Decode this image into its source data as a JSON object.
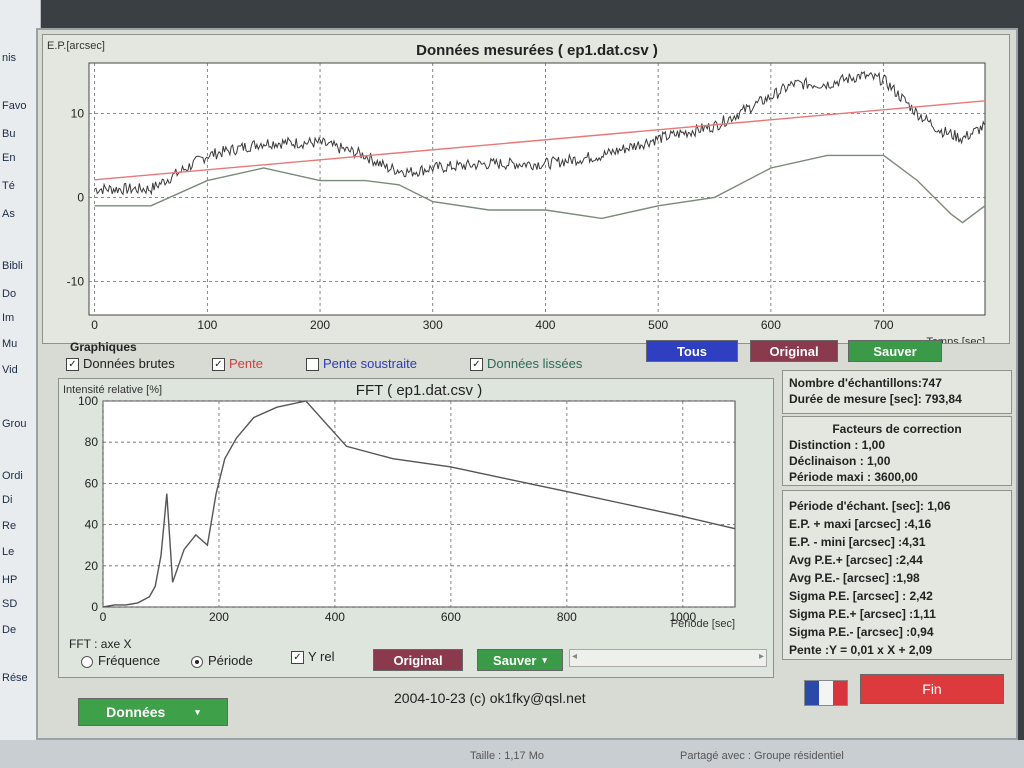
{
  "desktop": {
    "left_items": [
      "nis",
      "Favo",
      "Bu",
      "En",
      "Té",
      "As",
      "Bibli",
      "Do",
      "Im",
      "Mu",
      "Vid",
      "Grou",
      "Ordi",
      "Di",
      "Re",
      "Le",
      "HP",
      "SD",
      "De",
      "Rése"
    ]
  },
  "taskbar": {
    "size_text": "Taille : 1,17 Mo",
    "share_text": "Partagé avec : Groupe résidentiel"
  },
  "window": {
    "top_chart_title": "Données mesurées ( ep1.dat.csv )",
    "fft_chart_title": "FFT ( ep1.dat.csv )",
    "graphiques": {
      "label": "Graphiques",
      "donnees_brutes": "Données brutes",
      "pente": "Pente",
      "pente_soustraite": "Pente soustraite",
      "donnees_lissees": "Données lissées"
    },
    "buttons": {
      "tous": "Tous",
      "original_top": "Original",
      "sauver_top": "Sauver",
      "original_fft": "Original",
      "sauver_fft": "Sauver",
      "donnees": "Données",
      "fin": "Fin"
    },
    "fft_axe": {
      "label": "FFT : axe X",
      "frequence": "Fréquence",
      "periode": "Période",
      "y_rel": "Y rel"
    },
    "footer_text": "2004-10-23 (c) ok1fky@qsl.net",
    "colors": {
      "tous": "#2f3fc2",
      "original": "#8a3a4c",
      "sauver": "#3a9a48",
      "donnees": "#3fa04a",
      "fin": "#dd3a3e",
      "pente_line": "#e87878"
    }
  },
  "info": {
    "nombre": "Nombre d'échantillons:747",
    "duree": "Durée de mesure [sec]: 793,84",
    "facteurs_title": "Facteurs de correction",
    "distinction": "Distinction : 1,00",
    "declinaison": "Déclinaison : 1,00",
    "periode_maxi": "Période maxi : 3600,00",
    "stats": [
      "Période d'échant. [sec]: 1,06",
      "E.P. + maxi [arcsec] :4,16",
      "E.P. - mini [arcsec] :4,31",
      "Avg P.E.+ [arcsec] :2,44",
      "Avg P.E.- [arcsec] :1,98",
      "Sigma P.E. [arcsec] : 2,42",
      "Sigma P.E.+ [arcsec] :1,11",
      "Sigma P.E.- [arcsec] :0,94",
      "Pente :Y = 0,01 x X + 2,09"
    ]
  },
  "chart_data": [
    {
      "type": "line",
      "title": "Données mesurées ( ep1.dat.csv )",
      "ylabel": "E.P.[arcsec]",
      "xlabel": "Temps [sec]",
      "xlim": [
        -5,
        790
      ],
      "ylim": [
        -14,
        16
      ],
      "x_ticks": [
        0,
        100,
        200,
        300,
        400,
        500,
        600,
        700
      ],
      "y_ticks": [
        -10,
        0,
        10
      ],
      "grid": true,
      "series": [
        {
          "color": "#3a3a3a",
          "noisy": true,
          "x": [
            0,
            50,
            100,
            150,
            200,
            240,
            260,
            280,
            300,
            350,
            400,
            450,
            500,
            550,
            600,
            620,
            650,
            680,
            700,
            730,
            750,
            770,
            790
          ],
          "y": [
            1,
            1,
            5,
            6.5,
            6.5,
            5,
            3.5,
            3,
            3.5,
            4,
            4,
            5,
            7,
            8.5,
            12,
            13.5,
            13.5,
            14.5,
            14,
            10,
            8,
            7,
            8.5
          ]
        },
        {
          "color": "#e87878",
          "noisy": false,
          "x": [
            0,
            790
          ],
          "y": [
            2.09,
            11.5
          ]
        },
        {
          "color": "#7a8a7a",
          "noisy": false,
          "x": [
            0,
            50,
            100,
            150,
            200,
            240,
            270,
            300,
            350,
            400,
            450,
            500,
            550,
            600,
            650,
            680,
            700,
            730,
            760,
            770,
            790
          ],
          "y": [
            -1,
            -1,
            2,
            3.5,
            2,
            2,
            1.5,
            -0.5,
            -1.5,
            -1.5,
            -2.5,
            -1,
            0,
            3.5,
            5,
            5,
            5,
            2,
            -2,
            -3,
            -1
          ]
        }
      ]
    },
    {
      "type": "line",
      "title": "FFT ( ep1.dat.csv )",
      "ylabel": "Intensité relative [%]",
      "xlabel": "Période [sec]",
      "xlim": [
        0,
        1090
      ],
      "ylim": [
        0,
        100
      ],
      "x_ticks": [
        0,
        200,
        400,
        600,
        800,
        1000
      ],
      "y_ticks": [
        0,
        20,
        40,
        60,
        80,
        100
      ],
      "grid": true,
      "series": [
        {
          "color": "#555555",
          "noisy": false,
          "x": [
            0,
            20,
            40,
            60,
            80,
            90,
            100,
            110,
            120,
            140,
            160,
            180,
            195,
            210,
            230,
            260,
            300,
            350,
            420,
            500,
            600,
            700,
            800,
            900,
            1000,
            1090
          ],
          "y": [
            0,
            1,
            1,
            2,
            5,
            10,
            25,
            55,
            12,
            28,
            35,
            30,
            55,
            72,
            82,
            92,
            97,
            100,
            78,
            72,
            68,
            62,
            56,
            50,
            44,
            38
          ]
        }
      ]
    }
  ]
}
